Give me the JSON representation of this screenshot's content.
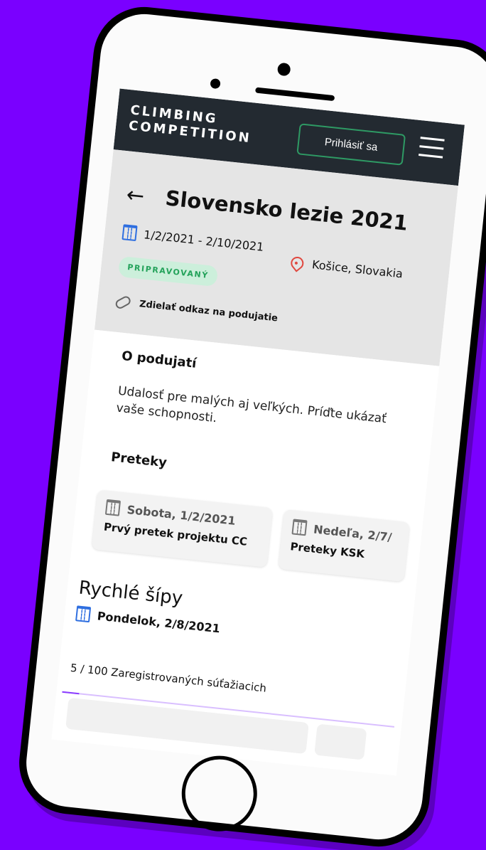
{
  "header": {
    "brand": "CLIMBING\nCOMPETITION",
    "login_label": "Prihlásiť sa"
  },
  "event": {
    "title": "Slovensko lezie 2021",
    "date_range": "1/2/2021 - 2/10/2021",
    "location": "Košice, Slovakia",
    "status": "PRIPRAVOVANÝ",
    "share_link": "Zdielať odkaz na podujatie",
    "status_color": "#23a25a",
    "status_bg": "#ccefdb"
  },
  "about": {
    "title": "O podujatí",
    "text": "Udalosť pre malých aj veľkých. Príďte ukázať vaše schopnosti."
  },
  "races": {
    "title": "Preteky",
    "items": [
      {
        "date": "Sobota, 1/2/2021",
        "name": "Prvý pretek projektu CC"
      },
      {
        "date": "Nedeľa, 2/7/",
        "name": "Preteky KSK"
      }
    ]
  },
  "featured_race": {
    "title": "Rychlé šípy",
    "date": "Pondelok, 2/8/2021",
    "registered_text": "5 / 100 Zaregistrovaných súťažiacich",
    "registered_fraction": 0.05
  },
  "colors": {
    "accent": "#8b3dff",
    "background": "#7a00ff",
    "topbar": "#232a31",
    "login_border": "#2e9a64",
    "calendar_icon": "#2f6fe0",
    "location_icon": "#e0483f"
  }
}
